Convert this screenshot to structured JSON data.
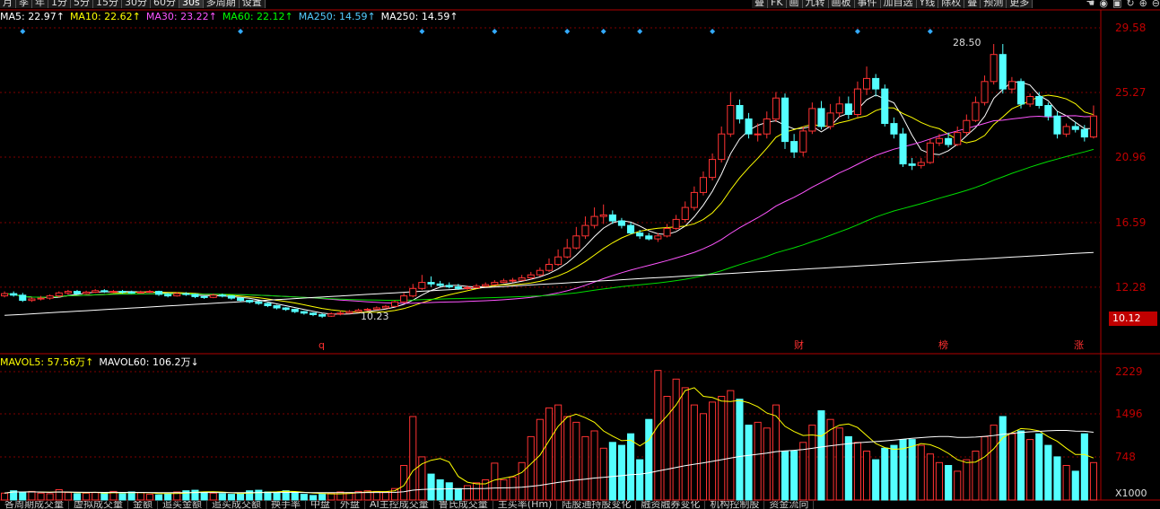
{
  "toolbar": {
    "periods": [
      "月",
      "季",
      "年",
      "1分",
      "5分",
      "15分",
      "30分",
      "60分",
      "30s",
      "多周期",
      "设置"
    ],
    "right_buttons": [
      "叠",
      "FK",
      "画",
      "九转",
      "画板",
      "事件",
      "加自选",
      "Y线",
      "除权",
      "叠",
      "预测",
      "更多"
    ],
    "icons": [
      "hand-icon",
      "eye-icon",
      "lock-icon",
      "refresh-icon",
      "zoom-in-icon",
      "zoom-out-icon"
    ]
  },
  "price_legend": [
    {
      "label": "MA5: 22.97↑",
      "color": "#ffffff"
    },
    {
      "label": "MA10: 22.62↑",
      "color": "#ffff00"
    },
    {
      "label": "MA30: 23.22↑",
      "color": "#ff55ff"
    },
    {
      "label": "MA60: 22.12↑",
      "color": "#00ff00"
    },
    {
      "label": "MA250: 14.59↑",
      "color": "#55ccff"
    },
    {
      "label": "MA250: 14.59↑",
      "color": "#ffffff"
    }
  ],
  "volume_legend": [
    {
      "label": "MAVOL5: 57.56万↑",
      "color": "#ffff00"
    },
    {
      "label": "MAVOL60: 106.2万↓",
      "color": "#ffffff"
    }
  ],
  "price_axis_labels": [
    "29.58",
    "25.27",
    "20.96",
    "16.59",
    "12.28"
  ],
  "current_price_tag": "10.12",
  "volume_axis_labels": [
    "2229",
    "1496",
    "748"
  ],
  "volume_unit": "X1000",
  "annotations": {
    "high": "28.50",
    "low": "10.23"
  },
  "event_markers": [
    "q",
    "财",
    "榜",
    "涨"
  ],
  "bottom_tabs": [
    "各周期成交量",
    "虚拟成交量",
    "金额",
    "追买金额",
    "追买成交额",
    "换手率",
    "中盘",
    "外盘",
    "AI主控成交量",
    "鲁氏成交量",
    "主买率(Hm)",
    "陆股通持股变化",
    "融资融券变化",
    "机构控制股",
    "资金流向"
  ],
  "colors": {
    "up": "#ff3232",
    "down": "#54ffff",
    "grid": "#800000",
    "axis_text": "#c00000"
  },
  "chart_data": {
    "type": "candlestick",
    "ylim": [
      10.12,
      29.58
    ],
    "x": [
      1,
      2,
      3,
      4,
      5,
      6,
      7,
      8,
      9,
      10,
      11,
      12,
      13,
      14,
      15,
      16,
      17,
      18,
      19,
      20,
      21,
      22,
      23,
      24,
      25,
      26,
      27,
      28,
      29,
      30,
      31,
      32,
      33,
      34,
      35,
      36,
      37,
      38,
      39,
      40,
      41,
      42,
      43,
      44,
      45,
      46,
      47,
      48,
      49,
      50,
      51,
      52,
      53,
      54,
      55,
      56,
      57,
      58,
      59,
      60,
      61,
      62,
      63,
      64,
      65,
      66,
      67,
      68,
      69,
      70,
      71,
      72,
      73,
      74,
      75,
      76,
      77,
      78,
      79,
      80,
      81,
      82,
      83,
      84,
      85,
      86,
      87,
      88,
      89,
      90,
      91,
      92,
      93,
      94,
      95,
      96,
      97,
      98,
      99,
      100,
      101,
      102,
      103,
      104,
      105,
      106,
      107,
      108,
      109,
      110,
      111,
      112,
      113,
      114,
      115,
      116,
      117,
      118,
      119,
      120,
      121
    ],
    "open": [
      11.7,
      11.85,
      11.75,
      11.4,
      11.5,
      11.55,
      11.7,
      11.9,
      12.0,
      11.85,
      11.95,
      12.05,
      12.0,
      12.0,
      11.95,
      11.9,
      11.95,
      12.0,
      11.8,
      11.7,
      11.85,
      11.8,
      11.65,
      11.6,
      11.75,
      11.7,
      11.55,
      11.4,
      11.3,
      11.2,
      11.05,
      10.9,
      10.8,
      10.65,
      10.55,
      10.45,
      10.35,
      10.5,
      10.55,
      10.65,
      10.75,
      10.8,
      10.9,
      11.0,
      11.3,
      11.7,
      12.2,
      12.6,
      12.5,
      12.4,
      12.3,
      12.2,
      12.25,
      12.35,
      12.45,
      12.6,
      12.7,
      12.75,
      12.9,
      13.1,
      13.4,
      13.8,
      14.3,
      14.9,
      15.7,
      16.4,
      17.0,
      17.1,
      16.7,
      16.4,
      15.9,
      15.7,
      15.5,
      15.7,
      16.2,
      16.8,
      17.6,
      18.6,
      19.6,
      20.8,
      22.5,
      24.4,
      23.5,
      22.5,
      22.5,
      23.5,
      24.9,
      22.0,
      21.3,
      22.7,
      24.2,
      23.0,
      23.9,
      24.5,
      23.8,
      25.5,
      26.2,
      25.5,
      23.2,
      22.5,
      20.5,
      20.4,
      20.6,
      21.9,
      22.2,
      21.8,
      22.6,
      23.4,
      24.6,
      26.0,
      27.8,
      25.5,
      26.0,
      24.5,
      25.0,
      24.4,
      23.7,
      22.5,
      23.0,
      22.8,
      22.3
    ],
    "close": [
      11.85,
      11.75,
      11.4,
      11.5,
      11.55,
      11.7,
      11.9,
      12.0,
      11.85,
      11.95,
      12.05,
      12.0,
      12.0,
      11.95,
      11.9,
      11.95,
      12.0,
      11.8,
      11.7,
      11.85,
      11.8,
      11.65,
      11.6,
      11.75,
      11.7,
      11.55,
      11.4,
      11.3,
      11.2,
      11.05,
      10.9,
      10.8,
      10.65,
      10.55,
      10.45,
      10.35,
      10.5,
      10.55,
      10.65,
      10.75,
      10.8,
      10.9,
      11.0,
      11.3,
      11.7,
      12.2,
      12.6,
      12.5,
      12.4,
      12.3,
      12.2,
      12.25,
      12.35,
      12.45,
      12.6,
      12.7,
      12.75,
      12.9,
      13.1,
      13.4,
      13.8,
      14.3,
      14.9,
      15.7,
      16.4,
      17.0,
      17.1,
      16.7,
      16.4,
      15.9,
      15.7,
      15.5,
      15.7,
      16.2,
      16.8,
      17.6,
      18.6,
      19.6,
      20.8,
      22.5,
      24.4,
      23.5,
      22.5,
      22.5,
      23.5,
      24.9,
      22.0,
      21.3,
      22.7,
      24.2,
      23.0,
      23.9,
      24.5,
      23.8,
      25.5,
      26.2,
      25.5,
      23.2,
      22.5,
      20.5,
      20.4,
      20.6,
      21.9,
      22.2,
      21.8,
      22.6,
      23.4,
      24.6,
      26.0,
      27.8,
      25.5,
      26.0,
      24.5,
      25.0,
      24.4,
      23.7,
      22.5,
      23.0,
      22.8,
      22.3,
      23.7
    ],
    "high": [
      12.0,
      12.0,
      11.9,
      11.6,
      11.7,
      11.8,
      12.0,
      12.1,
      12.1,
      12.05,
      12.15,
      12.15,
      12.1,
      12.1,
      12.05,
      12.05,
      12.1,
      12.05,
      11.9,
      11.95,
      11.95,
      11.85,
      11.75,
      11.85,
      11.85,
      11.75,
      11.6,
      11.45,
      11.35,
      11.25,
      11.1,
      10.95,
      10.85,
      10.7,
      10.6,
      10.55,
      10.6,
      10.7,
      10.75,
      10.85,
      10.9,
      11.0,
      11.1,
      11.4,
      11.9,
      12.5,
      13.1,
      13.0,
      12.7,
      12.6,
      12.5,
      12.4,
      12.5,
      12.6,
      12.75,
      12.85,
      12.9,
      13.1,
      13.3,
      13.6,
      14.2,
      14.8,
      15.5,
      16.3,
      17.0,
      17.6,
      17.8,
      17.4,
      16.9,
      16.6,
      16.1,
      15.9,
      15.9,
      16.5,
      17.1,
      18.0,
      19.0,
      20.0,
      21.2,
      23.0,
      25.3,
      24.8,
      23.9,
      23.2,
      24.0,
      25.3,
      25.2,
      22.5,
      23.0,
      24.6,
      24.7,
      24.5,
      25.0,
      25.0,
      26.0,
      27.0,
      26.5,
      25.8,
      23.6,
      22.9,
      20.9,
      20.9,
      22.2,
      22.5,
      22.6,
      23.0,
      23.8,
      25.0,
      26.4,
      28.5,
      28.5,
      26.3,
      26.2,
      25.2,
      25.3,
      24.6,
      24.0,
      23.2,
      23.3,
      23.1,
      24.4
    ],
    "low": [
      11.6,
      11.65,
      11.3,
      11.3,
      11.4,
      11.45,
      11.6,
      11.8,
      11.8,
      11.8,
      11.9,
      11.9,
      11.9,
      11.85,
      11.85,
      11.85,
      11.9,
      11.7,
      11.6,
      11.65,
      11.7,
      11.55,
      11.5,
      11.55,
      11.6,
      11.45,
      11.3,
      11.2,
      11.1,
      10.95,
      10.8,
      10.7,
      10.55,
      10.45,
      10.35,
      10.23,
      10.3,
      10.4,
      10.55,
      10.6,
      10.7,
      10.8,
      10.85,
      10.95,
      11.2,
      11.6,
      12.1,
      12.3,
      12.3,
      12.2,
      12.1,
      12.1,
      12.2,
      12.3,
      12.4,
      12.55,
      12.6,
      12.7,
      12.8,
      13.0,
      13.3,
      13.7,
      14.2,
      14.8,
      15.5,
      16.2,
      16.5,
      16.5,
      16.2,
      15.8,
      15.5,
      15.4,
      15.3,
      15.6,
      16.1,
      16.6,
      17.4,
      18.4,
      19.4,
      20.6,
      22.3,
      23.2,
      22.2,
      22.0,
      22.2,
      23.3,
      21.5,
      20.9,
      21.0,
      22.5,
      22.8,
      22.8,
      23.6,
      23.5,
      23.6,
      25.1,
      25.0,
      23.0,
      22.2,
      20.3,
      20.1,
      20.2,
      20.5,
      21.7,
      21.6,
      21.7,
      22.4,
      23.3,
      24.4,
      25.8,
      25.2,
      25.2,
      24.2,
      24.3,
      24.2,
      23.4,
      22.2,
      22.3,
      22.6,
      22.0,
      22.2
    ],
    "volume": [
      120,
      160,
      140,
      150,
      120,
      110,
      180,
      130,
      110,
      120,
      130,
      120,
      150,
      110,
      140,
      130,
      100,
      90,
      110,
      140,
      160,
      170,
      130,
      120,
      110,
      100,
      110,
      160,
      170,
      140,
      130,
      160,
      140,
      100,
      80,
      100,
      120,
      140,
      130,
      150,
      160,
      150,
      140,
      200,
      600,
      1450,
      750,
      450,
      350,
      300,
      200,
      250,
      300,
      350,
      640,
      350,
      400,
      650,
      1100,
      1400,
      1600,
      1650,
      1450,
      1350,
      1100,
      1200,
      900,
      1000,
      950,
      1150,
      700,
      1400,
      2250,
      1800,
      2100,
      1950,
      1650,
      1500,
      1700,
      1800,
      1900,
      1750,
      1300,
      1350,
      1250,
      1650,
      850,
      850,
      1000,
      1300,
      1550,
      1400,
      1250,
      1100,
      1000,
      850,
      700,
      900,
      950,
      1050,
      1050,
      950,
      800,
      650,
      600,
      500,
      700,
      850,
      1100,
      1300,
      1450,
      1150,
      1200,
      1050,
      1150,
      950,
      750,
      600,
      500,
      1150,
      650
    ]
  }
}
